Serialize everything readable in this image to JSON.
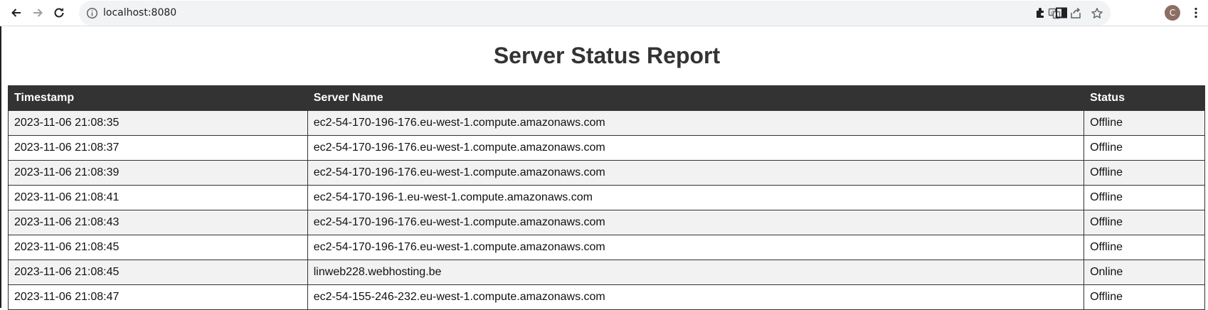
{
  "browser": {
    "url": "localhost:8080",
    "avatar_letter": "C",
    "icons": [
      "back-icon",
      "forward-icon",
      "reload-icon",
      "info-icon",
      "translate-icon",
      "share-icon",
      "star-icon",
      "extensions-icon",
      "side-panel-icon",
      "menu-icon"
    ]
  },
  "page": {
    "title": "Server Status Report"
  },
  "table": {
    "headers": [
      "Timestamp",
      "Server Name",
      "Status"
    ],
    "rows": [
      {
        "timestamp": "2023-11-06 21:08:35",
        "server": "ec2-54-170-196-176.eu-west-1.compute.amazonaws.com",
        "status": "Offline"
      },
      {
        "timestamp": "2023-11-06 21:08:37",
        "server": "ec2-54-170-196-176.eu-west-1.compute.amazonaws.com",
        "status": "Offline"
      },
      {
        "timestamp": "2023-11-06 21:08:39",
        "server": "ec2-54-170-196-176.eu-west-1.compute.amazonaws.com",
        "status": "Offline"
      },
      {
        "timestamp": "2023-11-06 21:08:41",
        "server": "ec2-54-170-196-1.eu-west-1.compute.amazonaws.com",
        "status": "Offline"
      },
      {
        "timestamp": "2023-11-06 21:08:43",
        "server": "ec2-54-170-196-176.eu-west-1.compute.amazonaws.com",
        "status": "Offline"
      },
      {
        "timestamp": "2023-11-06 21:08:45",
        "server": "ec2-54-170-196-176.eu-west-1.compute.amazonaws.com",
        "status": "Offline"
      },
      {
        "timestamp": "2023-11-06 21:08:45",
        "server": "linweb228.webhosting.be",
        "status": "Online"
      },
      {
        "timestamp": "2023-11-06 21:08:47",
        "server": "ec2-54-155-246-232.eu-west-1.compute.amazonaws.com",
        "status": "Offline"
      }
    ]
  }
}
